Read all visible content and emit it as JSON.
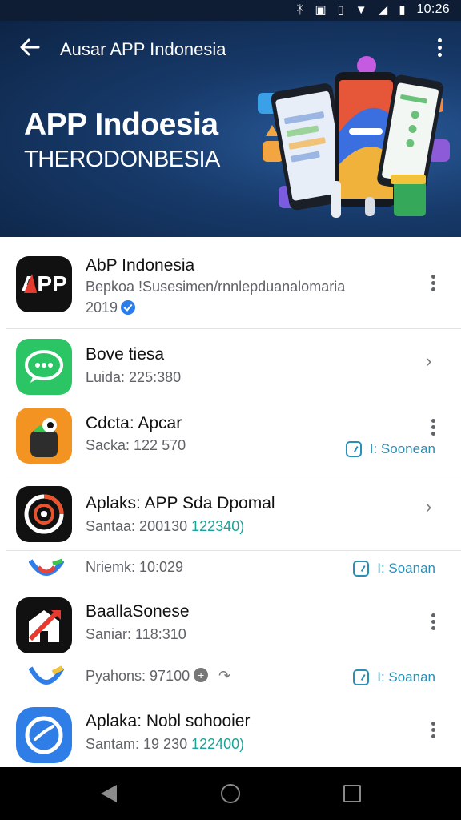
{
  "status_bar": {
    "time": "10:26",
    "icons": [
      "bluetooth-icon",
      "nfc-icon",
      "vibrate-icon",
      "wifi-icon",
      "signal-icon",
      "battery-icon"
    ]
  },
  "header": {
    "title": "Ausar APP Indonesia",
    "hero_title": "APP Indoesia",
    "hero_subtitle": "THERODONBESIA",
    "colors": {
      "bg_dark": "#0d2445",
      "bg_light": "#2a5c9c"
    }
  },
  "apps": [
    {
      "name": "AbP Indonesia",
      "description": "Bepkoa !Susesimen/rnnlepduanalomaria",
      "meta": "2019",
      "verified": true,
      "action": "more"
    },
    {
      "name": "Bove tiesa",
      "meta": "Luida: 225:380",
      "action": "chevron"
    },
    {
      "name": "Cdcta: Apcar",
      "meta": "Sacka: 122 570",
      "badge": "I: Soonean",
      "action": "more"
    },
    {
      "name": "Aplaks: APP Sda Dpomal",
      "meta_prefix": "Santaa:  200130",
      "meta_highlight": "122340)",
      "action": "chevron"
    },
    {
      "meta": "Nriemk: 10:029",
      "badge": "I: Soanan"
    },
    {
      "name": "BaallaSonese",
      "meta": "Saniar: 118:310",
      "action": "more"
    },
    {
      "meta": "Pyahons: 97100",
      "badge": "I: Soanan"
    },
    {
      "name": "Aplaka: Nobl sohooier",
      "meta_prefix": "Santam: 19 230",
      "meta_highlight": "122400)",
      "action": "more"
    }
  ],
  "nav": {
    "buttons": [
      "back-icon",
      "home-icon",
      "recents-icon"
    ]
  }
}
